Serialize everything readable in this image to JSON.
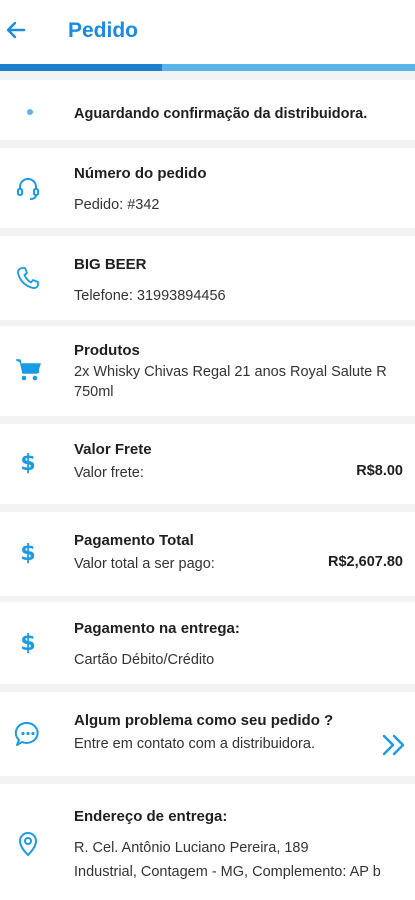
{
  "header": {
    "title": "Pedido",
    "progress_fraction": 0.39
  },
  "status": {
    "text": "Aguardando confirmação da distribuidora."
  },
  "order": {
    "label": "Número do pedido",
    "value": "Pedido: #342"
  },
  "distributor": {
    "name": "BIG BEER",
    "phone": "Telefone: 31993894456"
  },
  "products": {
    "label": "Produtos",
    "line1": "2x Whisky Chivas Regal 21 anos Royal Salute R",
    "line2": "750ml"
  },
  "shipping": {
    "label": "Valor Frete",
    "text": "Valor frete:",
    "value": "R$8.00"
  },
  "total": {
    "label": "Pagamento Total",
    "text": "Valor total a ser pago:",
    "value": "R$2,607.80"
  },
  "payment": {
    "label": "Pagamento na entrega:",
    "method": "Cartão Débito/Crédito"
  },
  "support": {
    "label": "Algum problema como seu pedido ?",
    "text": "Entre em contato com a distribuidora."
  },
  "address": {
    "label": "Endereço de entrega:",
    "line1": "R. Cel. Antônio Luciano Pereira, 189",
    "line2": "Industrial, Contagem - MG, Complemento: AP b"
  },
  "colors": {
    "accent": "#1a8ae2",
    "icon": "#1a9be6",
    "progress_track": "#5ab4ec",
    "progress_fill": "#1e7fd0",
    "background": "#f2f3f5"
  },
  "icons": {
    "back": "arrow-left-icon",
    "order": "headset-icon",
    "phone": "phone-icon",
    "products": "cart-icon",
    "shipping": "dollar-icon",
    "total": "dollar-icon",
    "payment": "dollar-icon",
    "support": "chat-bubble-icon",
    "support_action": "double-chevron-right-icon",
    "address": "location-pin-icon"
  }
}
